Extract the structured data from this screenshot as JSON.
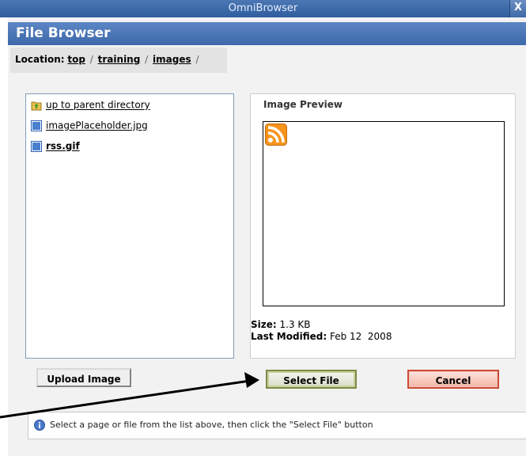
{
  "window": {
    "title": "OmniBrowser",
    "close_label": "X"
  },
  "header": {
    "title": "File Browser"
  },
  "location": {
    "label": "Location:",
    "crumbs": [
      "top",
      "training",
      "images"
    ],
    "separator": "/"
  },
  "files": [
    {
      "label": "up to parent directory",
      "icon": "parent-folder-icon"
    },
    {
      "label": "imagePlaceholder.jpg",
      "icon": "file-icon"
    },
    {
      "label": "rss.gif",
      "icon": "file-icon",
      "selected": true
    }
  ],
  "preview": {
    "title": "Image Preview",
    "size_label": "Size:",
    "size_value": "1.3 KB",
    "modified_label": "Last Modified:",
    "modified_value": "Feb 12  2008"
  },
  "buttons": {
    "upload": "Upload Image",
    "select": "Select File",
    "cancel": "Cancel"
  },
  "info": {
    "text": "Select a page or file from the list above, then click the \"Select File\" button"
  },
  "colors": {
    "header": "#3d69aa",
    "select_border": "#7c8a49",
    "cancel_border": "#cc4a36"
  }
}
